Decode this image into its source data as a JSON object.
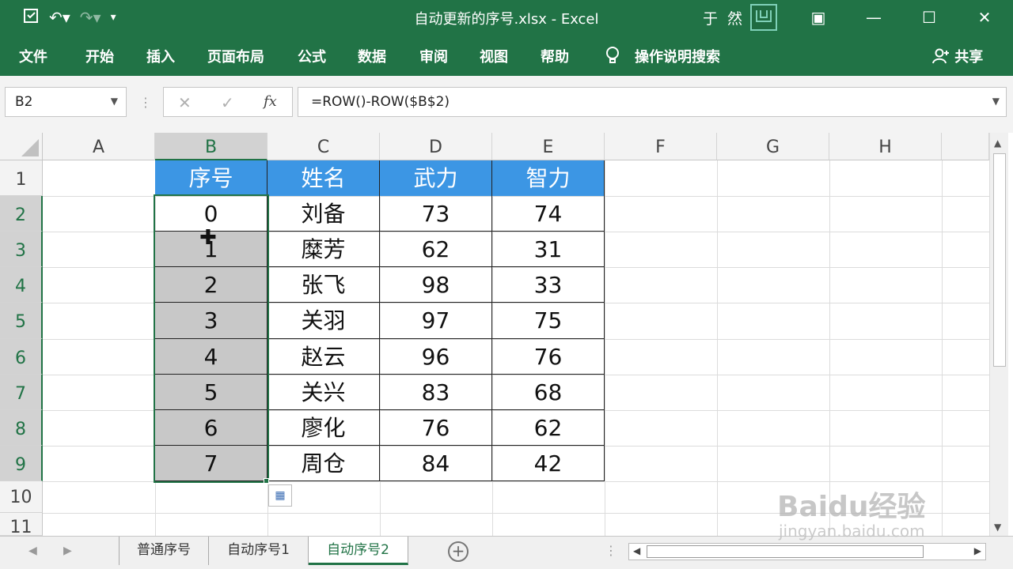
{
  "window": {
    "title": "自动更新的序号.xlsx  -  Excel",
    "user": "于 然",
    "avatar_text": "□"
  },
  "ribbon": {
    "tabs": [
      "文件",
      "开始",
      "插入",
      "页面布局",
      "公式",
      "数据",
      "审阅",
      "视图",
      "帮助"
    ],
    "tell_me": "操作说明搜索",
    "share": "共享"
  },
  "formula_bar": {
    "name_box": "B2",
    "formula": "=ROW()-ROW($B$2)",
    "fx": "fx"
  },
  "columns": [
    "A",
    "B",
    "C",
    "D",
    "E",
    "F",
    "G",
    "H"
  ],
  "rows": [
    "1",
    "2",
    "3",
    "4",
    "5",
    "6",
    "7",
    "8",
    "9",
    "10",
    "11"
  ],
  "table": {
    "headers": [
      "序号",
      "姓名",
      "武力",
      "智力"
    ],
    "rows": [
      [
        "0",
        "刘备",
        "73",
        "74"
      ],
      [
        "1",
        "糜芳",
        "62",
        "31"
      ],
      [
        "2",
        "张飞",
        "98",
        "33"
      ],
      [
        "3",
        "关羽",
        "97",
        "75"
      ],
      [
        "4",
        "赵云",
        "96",
        "76"
      ],
      [
        "5",
        "关兴",
        "83",
        "68"
      ],
      [
        "6",
        "廖化",
        "76",
        "62"
      ],
      [
        "7",
        "周仓",
        "84",
        "42"
      ]
    ]
  },
  "sheets": {
    "tabs": [
      "普通序号",
      "自动序号1",
      "自动序号2"
    ],
    "active_index": 2
  },
  "watermark": {
    "brand": "Baidu经验",
    "url": "jingyan.baidu.com"
  },
  "colors": {
    "excel_green": "#217346",
    "header_blue": "#3c96e4",
    "selection_gray": "#c8c8c8"
  }
}
